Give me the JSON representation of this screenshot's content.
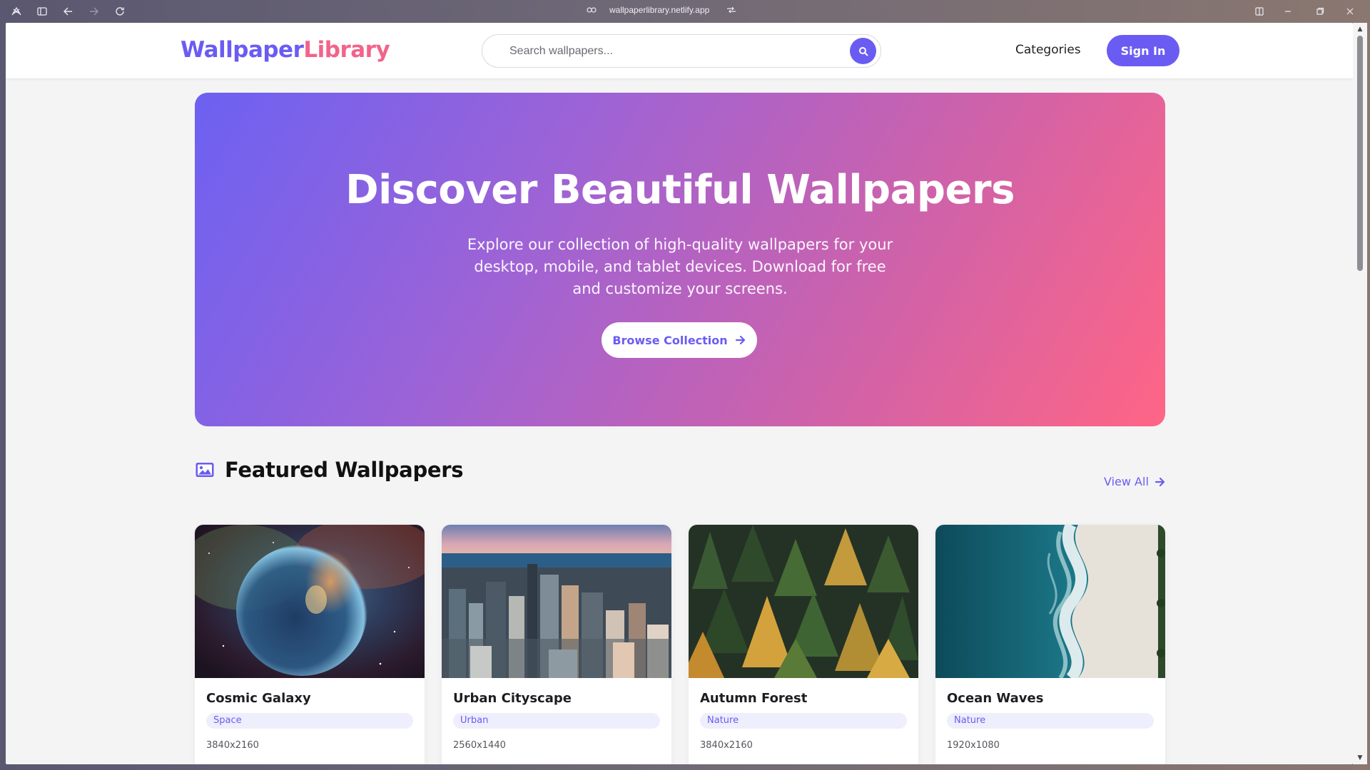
{
  "browser": {
    "url": "wallpaperlibrary.netlify.app"
  },
  "header": {
    "logo_part1": "Wallpaper",
    "logo_part2": "Library",
    "search_placeholder": "Search wallpapers...",
    "nav_categories": "Categories",
    "signin_label": "Sign In"
  },
  "hero": {
    "title": "Discover Beautiful Wallpapers",
    "subtitle": "Explore our collection of high-quality wallpapers for your desktop, mobile, and tablet devices. Download for free and customize your screens.",
    "browse_label": "Browse Collection"
  },
  "featured": {
    "title": "Featured Wallpapers",
    "view_all": "View All",
    "cards": [
      {
        "title": "Cosmic Galaxy",
        "tag": "Space",
        "resolution": "3840x2160"
      },
      {
        "title": "Urban Cityscape",
        "tag": "Urban",
        "resolution": "2560x1440"
      },
      {
        "title": "Autumn Forest",
        "tag": "Nature",
        "resolution": "3840x2160"
      },
      {
        "title": "Ocean Waves",
        "tag": "Nature",
        "resolution": "1920x1080"
      }
    ]
  },
  "colors": {
    "accent": "#6a5cf2",
    "brand_pink": "#f2638a",
    "hero_start": "#6c61f2",
    "hero_end": "#ff6585"
  }
}
